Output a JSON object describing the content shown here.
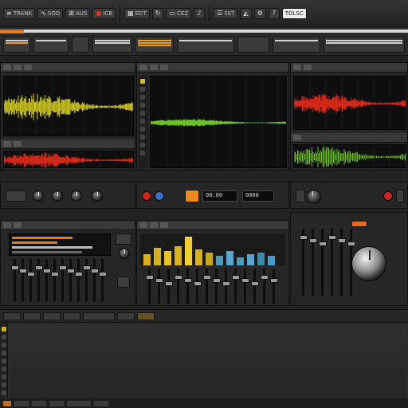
{
  "toolbar": {
    "items": [
      {
        "icon": "menu-icon",
        "glyph": "≡",
        "label": "TRANK"
      },
      {
        "icon": "waveform-icon",
        "glyph": "∿",
        "label": "SOD"
      },
      {
        "icon": "mixer-icon",
        "glyph": "⊞",
        "label": "AUS"
      },
      {
        "icon": "record-icon",
        "glyph": "●",
        "label": "ICB"
      },
      {
        "icon": "grid-icon",
        "glyph": "▦",
        "label": "EDT"
      },
      {
        "icon": "loop-icon",
        "glyph": "↻",
        "label": ""
      },
      {
        "icon": "clip-icon",
        "glyph": "▭",
        "label": "CEZ"
      },
      {
        "icon": "note-icon",
        "glyph": "♪",
        "label": ""
      },
      {
        "icon": "list-icon",
        "glyph": "☰",
        "label": "SET"
      },
      {
        "icon": "metronome-icon",
        "glyph": "◭",
        "label": ""
      },
      {
        "icon": "settings-icon",
        "glyph": "⚙",
        "label": ""
      },
      {
        "icon": "help-icon",
        "glyph": "?",
        "label": ""
      }
    ],
    "brand": "TOLSC"
  },
  "colors": {
    "accent": "#e87a1c",
    "wave_yellow": "#d8d020",
    "wave_red": "#d02818",
    "wave_green": "#6cc028",
    "meter_blue": "#5aa6c8"
  },
  "mixer": {
    "display_left": "00:00",
    "display_right": "0000"
  },
  "meters": {
    "levels": [
      0.35,
      0.55,
      0.45,
      0.6,
      0.9,
      0.5,
      0.4,
      0.3,
      0.45,
      0.25,
      0.35,
      0.4,
      0.3
    ]
  }
}
